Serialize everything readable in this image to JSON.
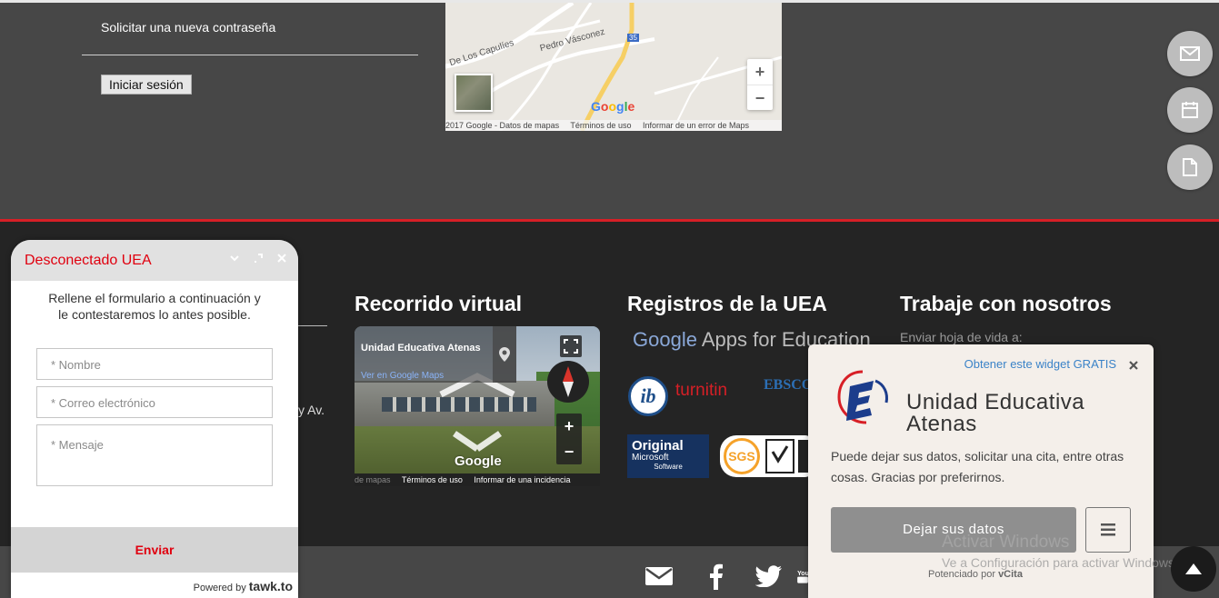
{
  "login": {
    "lost_password": "Solicitar una nueva contraseña",
    "login_button": "Iniciar sesión"
  },
  "map": {
    "street1": "De Los Capulíes",
    "street2": "Pedro Vásconez",
    "route": "35",
    "zoom_in": "+",
    "zoom_out": "−",
    "logo": "Google",
    "footer": {
      "copyright": "2017 Google - Datos de mapas",
      "terms": "Términos de uso",
      "report": "Informar de un error de Maps"
    }
  },
  "columns": {
    "tour_title": "Recorrido virtual",
    "registries_title": "Registros de la UEA",
    "jobs_title": "Trabaje con nosotros",
    "jobs_sub": "Enviar hoja de vida a:",
    "partial_address": "y Av."
  },
  "tour": {
    "place_name": "Unidad Educativa Atenas",
    "view_link": "Ver en Google Maps",
    "logo": "Google",
    "zoom_in": "+",
    "zoom_out": "−",
    "footer": {
      "data": "de mapas",
      "terms": "Términos de uso",
      "report": "Informar de una incidencia"
    }
  },
  "logos": {
    "google_apps": "Apps for Education",
    "google_word": "Google",
    "ib": "ib",
    "turnitin": "turnitin",
    "ebsco": "EBSCO",
    "ms_line1": "Original",
    "ms_line2": "Microsoft",
    "ms_line3": "Software",
    "sgs": "SGS"
  },
  "chat": {
    "title": "Desconectado UEA",
    "intro": "Rellene el formulario a continuación y le contestaremos lo antes posible.",
    "name_placeholder": "* Nombre",
    "email_placeholder": "* Correo electrónico",
    "message_placeholder": "* Mensaje",
    "send": "Enviar",
    "powered_prefix": "Powered by",
    "powered_brand": "tawk.to"
  },
  "vcita": {
    "get_widget": "Obtener este widget GRATIS",
    "business_name": "Unidad Educativa Atenas",
    "description": "Puede dejar sus datos, solicitar una cita, entre otras cosas. Gracias por preferirnos.",
    "cta": "Dejar sus datos",
    "powered_prefix": "Potenciado por",
    "powered_brand": "vCita"
  },
  "watermark": {
    "line1": "Activar Windows",
    "line2": "Ve a Configuración para activar Windows."
  },
  "icons": {
    "fab1": "envelope-icon",
    "fab2": "calendar-icon",
    "fab3": "document-icon",
    "social": [
      "envelope-icon",
      "facebook-icon",
      "twitter-icon",
      "youtube-icon"
    ]
  },
  "colors": {
    "accent_red": "#d71f26",
    "chat_red": "#e0000f",
    "link_blue": "#3b83c8"
  }
}
